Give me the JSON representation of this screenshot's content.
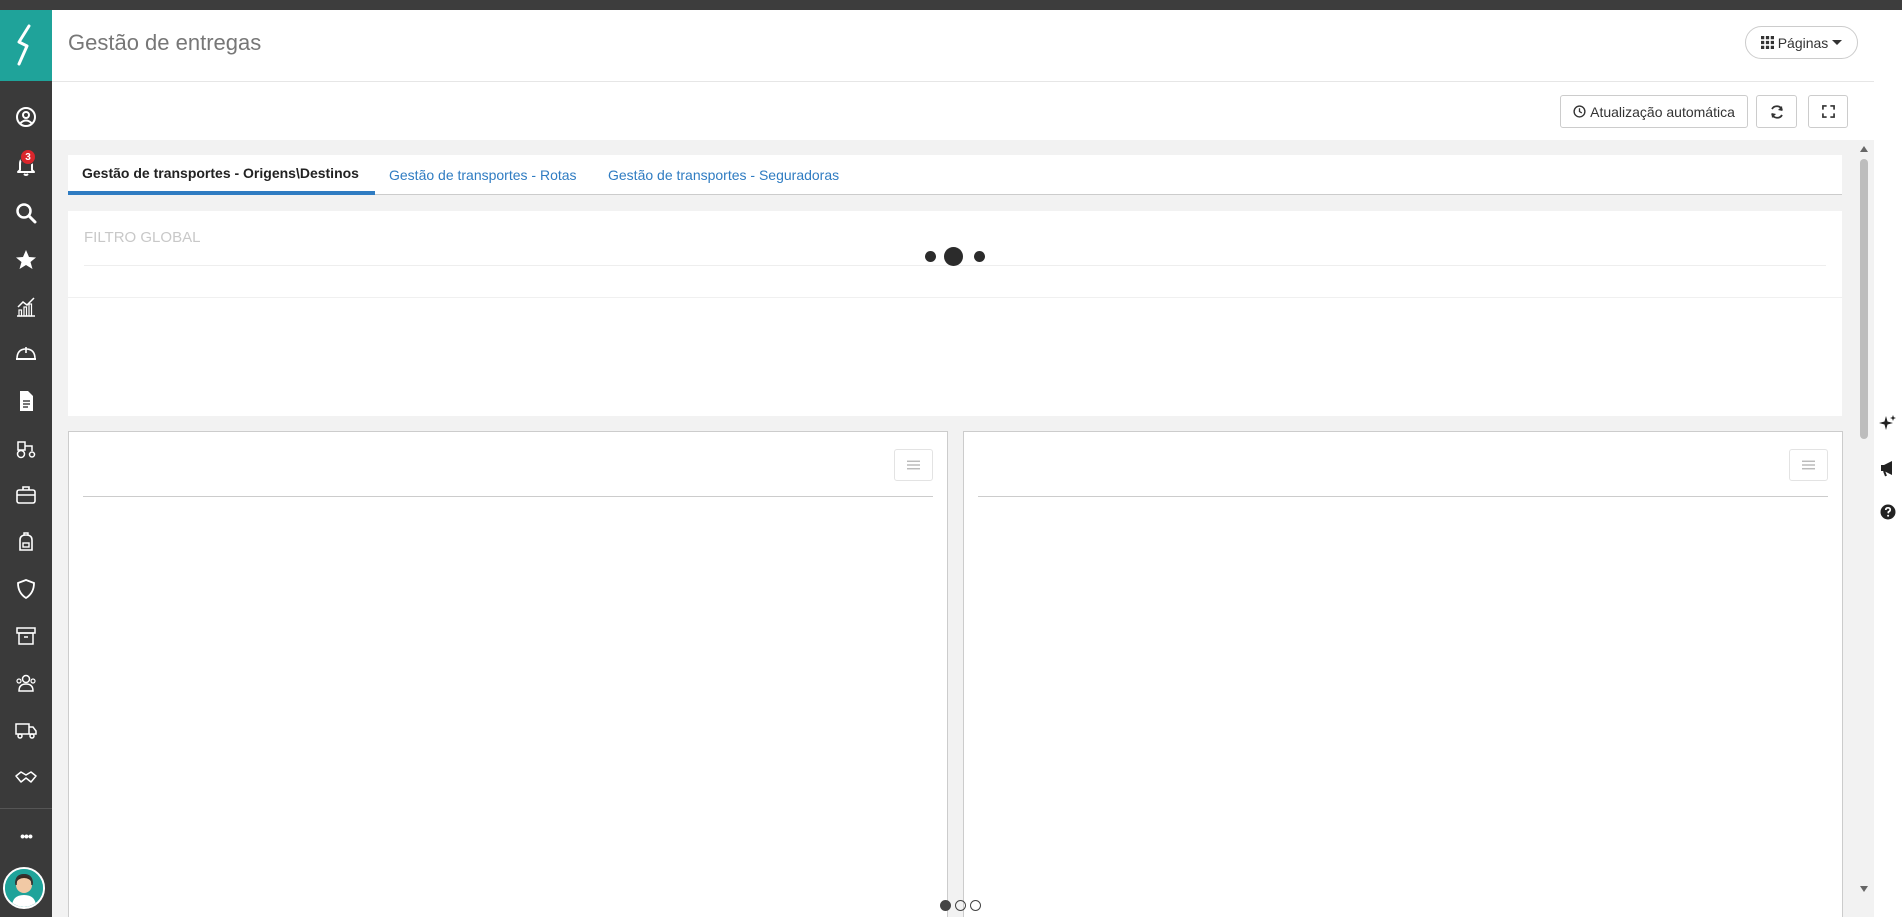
{
  "header": {
    "title": "Gestão de entregas",
    "pages_label": "Páginas"
  },
  "toolbar": {
    "auto_refresh_label": "Atualização automática"
  },
  "tabs": [
    {
      "label": "Gestão de transportes - Origens\\Destinos",
      "active": true
    },
    {
      "label": "Gestão de transportes - Rotas",
      "active": false
    },
    {
      "label": "Gestão de transportes - Seguradoras",
      "active": false
    }
  ],
  "filter": {
    "title": "FILTRO GLOBAL"
  },
  "sidebar": {
    "notification_count": "3",
    "more_label": "•••",
    "items": [
      "user-circle-icon",
      "bell-icon",
      "search-icon",
      "star-icon",
      "chart-icon",
      "hard-hat-icon",
      "document-icon",
      "tractor-icon",
      "briefcase-icon",
      "backpack-icon",
      "shield-icon",
      "box-icon",
      "people-icon",
      "truck-icon",
      "handshake-icon"
    ]
  },
  "colors": {
    "brand": "#1fa39a",
    "sidebar": "#3a3a3a",
    "link": "#2f7cc2",
    "badge": "#d9262c"
  },
  "pager": {
    "pages": 3,
    "current": 1
  }
}
